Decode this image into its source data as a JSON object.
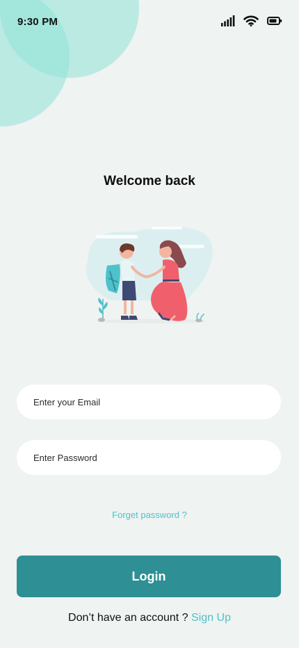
{
  "status_bar": {
    "time": "9:30 PM",
    "icons": [
      "signal-icon",
      "wifi-icon",
      "battery-icon"
    ]
  },
  "header": {
    "title": "Welcome back"
  },
  "illustration": {
    "subject": "woman-kneeling-holding-hands-with-child-with-backpack"
  },
  "form": {
    "email_placeholder": "Enter your Email",
    "password_placeholder": "Enter Password",
    "forgot_label": "Forget password ?",
    "login_label": "Login"
  },
  "signup": {
    "prompt": "Don’t have an account ?",
    "link_label": "Sign Up"
  },
  "colors": {
    "background": "#EFF3F1",
    "accent": "#4FC1CB",
    "primary_button": "#2E8F95",
    "decor_circle": "#8FE1D7",
    "illustration_dress": "#F0606C",
    "illustration_backpack": "#4FC1CB"
  }
}
